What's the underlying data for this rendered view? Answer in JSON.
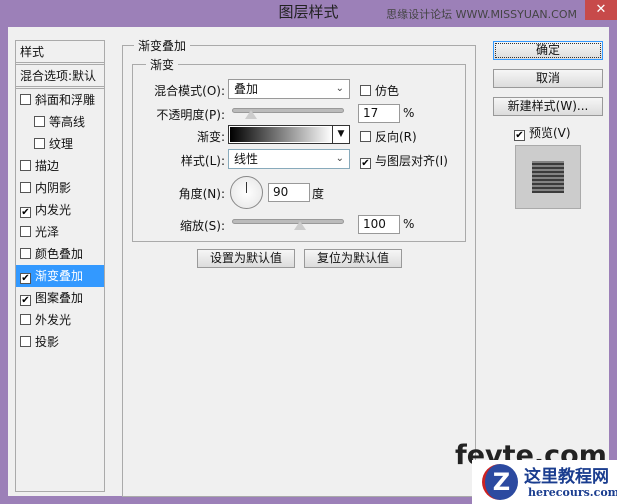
{
  "window": {
    "title": "图层样式",
    "watermark": "思缘设计论坛 WWW.MISSYUAN.COM",
    "close": "✕"
  },
  "sidebar": {
    "header": "样式",
    "blend": "混合选项:默认",
    "items": [
      {
        "label": "斜面和浮雕",
        "checked": false,
        "indent": false
      },
      {
        "label": "等高线",
        "checked": false,
        "indent": true
      },
      {
        "label": "纹理",
        "checked": false,
        "indent": true
      },
      {
        "label": "描边",
        "checked": false,
        "indent": false
      },
      {
        "label": "内阴影",
        "checked": false,
        "indent": false
      },
      {
        "label": "内发光",
        "checked": true,
        "indent": false
      },
      {
        "label": "光泽",
        "checked": false,
        "indent": false
      },
      {
        "label": "颜色叠加",
        "checked": false,
        "indent": false
      },
      {
        "label": "渐变叠加",
        "checked": true,
        "indent": false,
        "selected": true
      },
      {
        "label": "图案叠加",
        "checked": true,
        "indent": false
      },
      {
        "label": "外发光",
        "checked": false,
        "indent": false
      },
      {
        "label": "投影",
        "checked": false,
        "indent": false
      }
    ]
  },
  "panel": {
    "title": "渐变叠加",
    "group": "渐变",
    "blend_label": "混合模式(O):",
    "blend_value": "叠加",
    "dither": "仿色",
    "opacity_label": "不透明度(P):",
    "opacity": "17",
    "pct": "%",
    "gradient_label": "渐变:",
    "reverse": "反向(R)",
    "style_label": "样式(L):",
    "style_value": "线性",
    "align": "与图层对齐(I)",
    "angle_label": "角度(N):",
    "angle": "90",
    "deg": "度",
    "scale_label": "缩放(S):",
    "scale": "100",
    "set_default": "设置为默认值",
    "reset_default": "复位为默认值"
  },
  "right": {
    "ok": "确定",
    "cancel": "取消",
    "new_style": "新建样式(W)...",
    "preview": "预览(V)"
  },
  "logos": {
    "fevte": "fevte.com",
    "site": "这里教程网",
    "url": "herecours.com"
  }
}
